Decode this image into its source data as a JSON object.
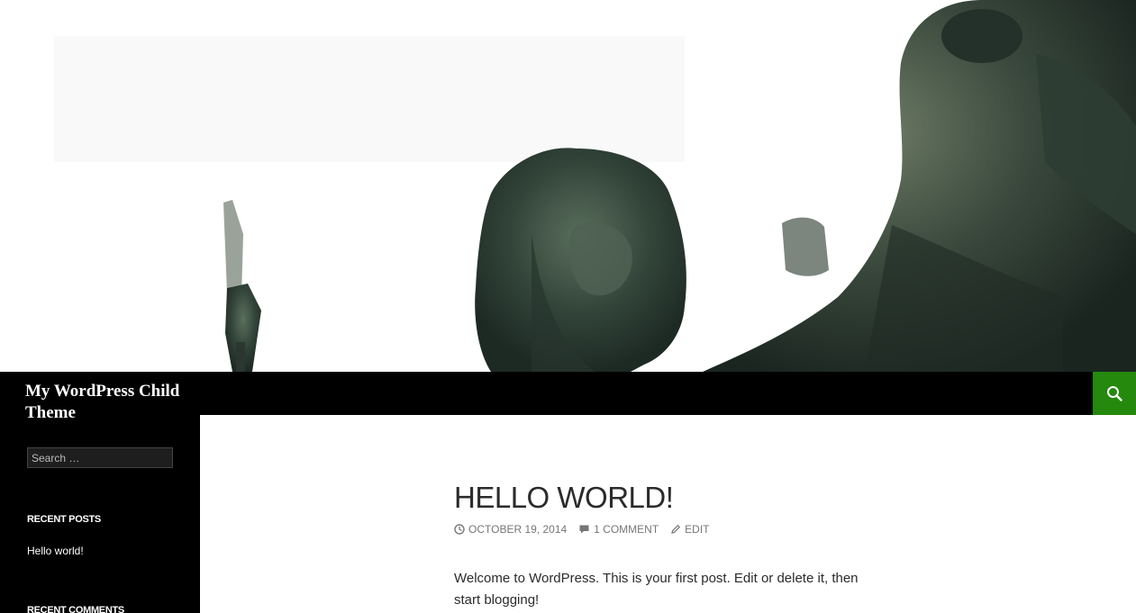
{
  "site": {
    "title": "My WordPress Child Theme"
  },
  "search": {
    "placeholder": "Search …"
  },
  "sidebar": {
    "recent_posts_title": "RECENT POSTS",
    "recent_posts": [
      "Hello world!"
    ],
    "recent_comments_title": "RECENT COMMENTS"
  },
  "post": {
    "title": "HELLO WORLD!",
    "date": "OCTOBER 19, 2014",
    "comments": "1 COMMENT",
    "edit": "EDIT",
    "content": "Welcome to WordPress. This is your first post. Edit or delete it, then start blogging!"
  },
  "icons": {
    "search": "search-icon",
    "clock": "clock-icon",
    "comment": "comment-icon",
    "edit": "pencil-icon"
  },
  "colors": {
    "accent": "#24890d",
    "masthead": "#000000",
    "sidebar": "#000000",
    "text": "#2b2b2b",
    "meta": "#767676"
  }
}
